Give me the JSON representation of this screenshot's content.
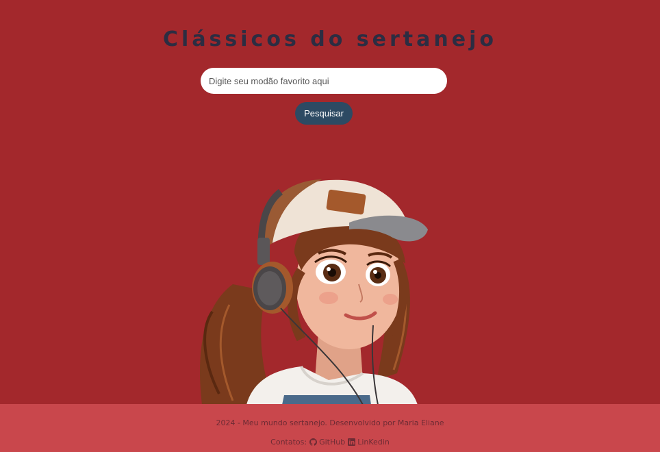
{
  "header": {
    "title": "Clássicos do sertanejo"
  },
  "search": {
    "placeholder": "Digite seu modão favorito aqui",
    "value": "",
    "button_label": "Pesquisar"
  },
  "illustration": {
    "icon": "girl-with-headphones-illustration"
  },
  "footer": {
    "credit": "2024 - Meu mundo sertanejo. Desenvolvido por Maria Eliane",
    "contacts_label": "Contatos:",
    "links": [
      {
        "icon": "github-icon",
        "label": "GitHub"
      },
      {
        "icon": "linkedin-icon",
        "label": "LinKedin"
      }
    ]
  },
  "colors": {
    "background": "#a3282c",
    "footer_background": "#c9474c",
    "title": "#2c2d42",
    "button": "#2d4a63",
    "footer_text": "#6e2b34"
  }
}
